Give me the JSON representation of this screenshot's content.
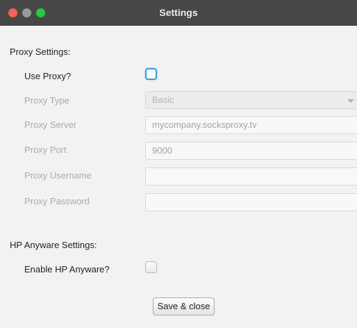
{
  "window": {
    "title": "Settings"
  },
  "proxy": {
    "heading": "Proxy Settings:",
    "use_proxy_label": "Use Proxy?",
    "use_proxy_checked": false,
    "type_label": "Proxy Type",
    "type_value": "Basic",
    "server_label": "Proxy Server",
    "server_value": "mycompany.socksproxy.tv",
    "port_label": "Proxy Port",
    "port_value": "9000",
    "username_label": "Proxy Username",
    "username_value": "",
    "password_label": "Proxy Password",
    "password_value": ""
  },
  "hp_anyware": {
    "heading": "HP Anyware Settings:",
    "enable_label": "Enable HP Anyware?",
    "enable_checked": false
  },
  "actions": {
    "save_label": "Save & close"
  },
  "colors": {
    "titlebar": "#474747",
    "close_dot": "#fe5f57",
    "minimize_dot": "#9a9a9a",
    "maximize_dot": "#28c840",
    "focus_ring": "#3a9dd9"
  },
  "icons": {
    "close": "close-dot-icon",
    "minimize": "minimize-dot-icon",
    "maximize": "maximize-dot-icon",
    "dropdown": "chevron-down-icon"
  }
}
